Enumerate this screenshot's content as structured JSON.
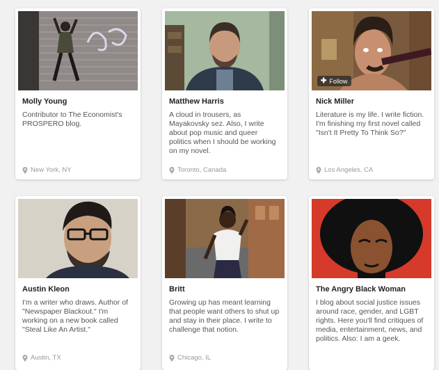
{
  "cards": [
    {
      "name": "Molly Young",
      "bio": "Contributor to The Economist's PROSPERO blog.",
      "location": "New York, NY",
      "icon": "location-pin-icon"
    },
    {
      "name": "Matthew Harris",
      "bio": "A cloud in trousers, as Mayakovsky sez. Also, I write about pop music and queer politics when I should be working on my novel.",
      "location": "Toronto, Canada",
      "icon": "location-pin-icon"
    },
    {
      "name": "Nick Miller",
      "bio": "Literature is my life. I write fiction. I'm finishing my first novel called \"Isn't It Pretty To Think So?\"",
      "location": "Los Angeles, CA",
      "follow_label": "Follow",
      "icon": "location-pin-icon"
    },
    {
      "name": "Austin Kleon",
      "bio": "I'm a writer who draws. Author of \"Newspaper Blackout.\" I'm working on a new book called \"Steal Like An Artist.\"",
      "location": "Austin, TX",
      "icon": "location-pin-icon"
    },
    {
      "name": "Britt",
      "bio": "Growing up has meant learning that people want others to shut up and stay in their place. I write to challenge that notion.",
      "location": "Chicago, IL",
      "icon": "location-pin-icon"
    },
    {
      "name": "The Angry Black Woman",
      "bio": "I blog about social justice issues around race, gender, and LGBT rights. Here you'll find critiques of media, entertainment, news, and politics. Also: I am a geek.",
      "location": "",
      "icon": "location-pin-icon"
    }
  ]
}
